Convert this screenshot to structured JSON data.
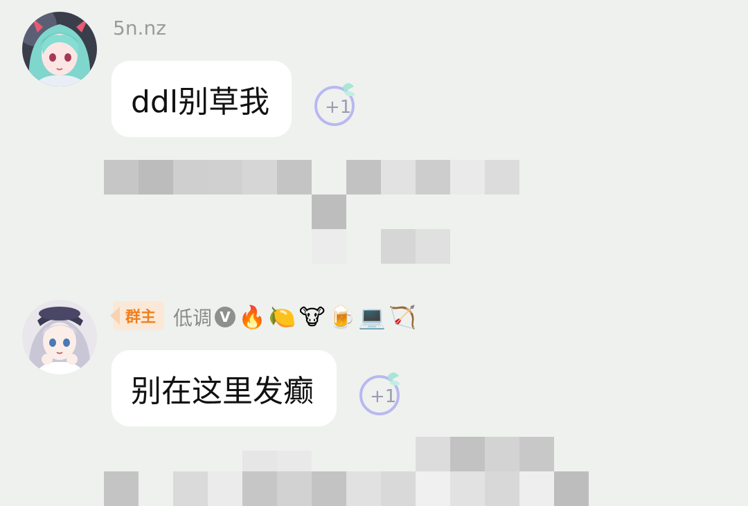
{
  "messages": [
    {
      "sender": "5n.nz",
      "text": "ddl别草我",
      "avatar_icon": "anime-girl-avatar-teal-hair"
    },
    {
      "role_badge": "群主",
      "sender": "低调",
      "verified_icon": "verified-v-icon",
      "title_emojis": [
        "🔥",
        "🍋",
        "🐮",
        "🍺",
        "💻",
        "🏹"
      ],
      "text": "别在这里发癫",
      "avatar_icon": "anime-girl-avatar-silver-hair"
    }
  ],
  "plus_one_icon": "plus-one-reaction-icon",
  "colors": {
    "background": "#eff1ef",
    "bubble": "#ffffff",
    "badge_bg": "#fbe8d6",
    "badge_text": "#f07f1f",
    "name_text": "#9a9a9a"
  }
}
